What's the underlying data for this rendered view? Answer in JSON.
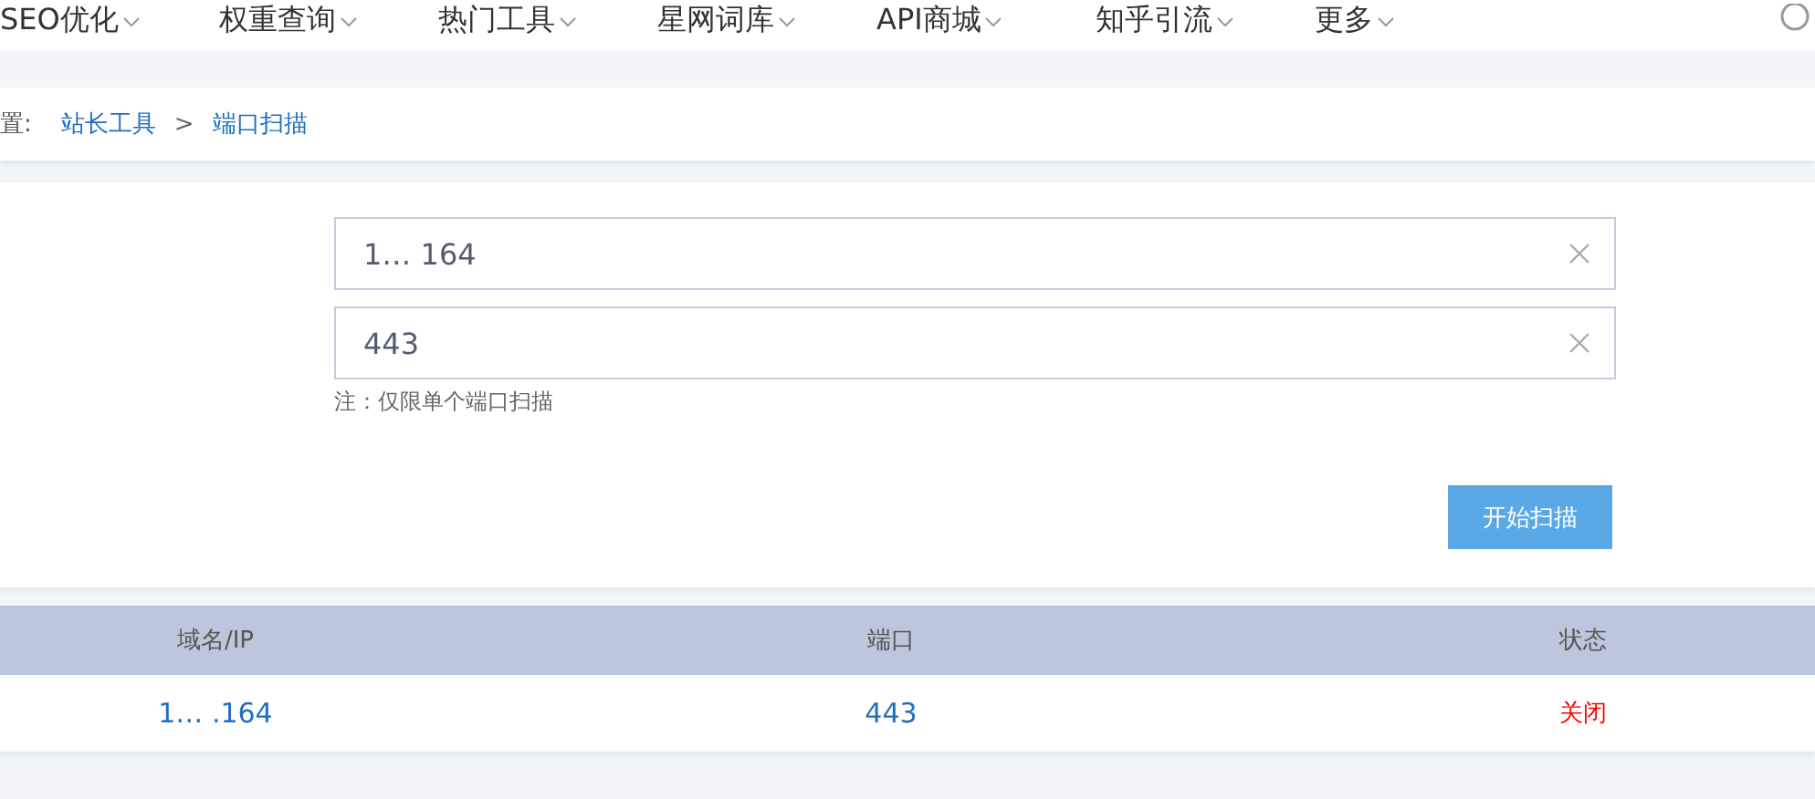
{
  "nav": {
    "items": [
      {
        "label": "SEO优化"
      },
      {
        "label": "权重查询"
      },
      {
        "label": "热门工具"
      },
      {
        "label": "星网词库"
      },
      {
        "label": "API商城"
      },
      {
        "label": "知乎引流"
      },
      {
        "label": "更多"
      }
    ]
  },
  "breadcrumb": {
    "prefix": "置:",
    "items": [
      {
        "label": "站长工具"
      },
      {
        "label": "端口扫描"
      }
    ],
    "separator": ">"
  },
  "form": {
    "fields": [
      {
        "value": "1… 164"
      },
      {
        "value": "443"
      }
    ],
    "note": "注：仅限单个端口扫描",
    "button": "开始扫描"
  },
  "table": {
    "columns": [
      "域名/IP",
      "端口",
      "状态"
    ],
    "rows": [
      {
        "host": "1… .164",
        "port": "443",
        "status": "关闭",
        "color": "#ff0000"
      }
    ]
  }
}
